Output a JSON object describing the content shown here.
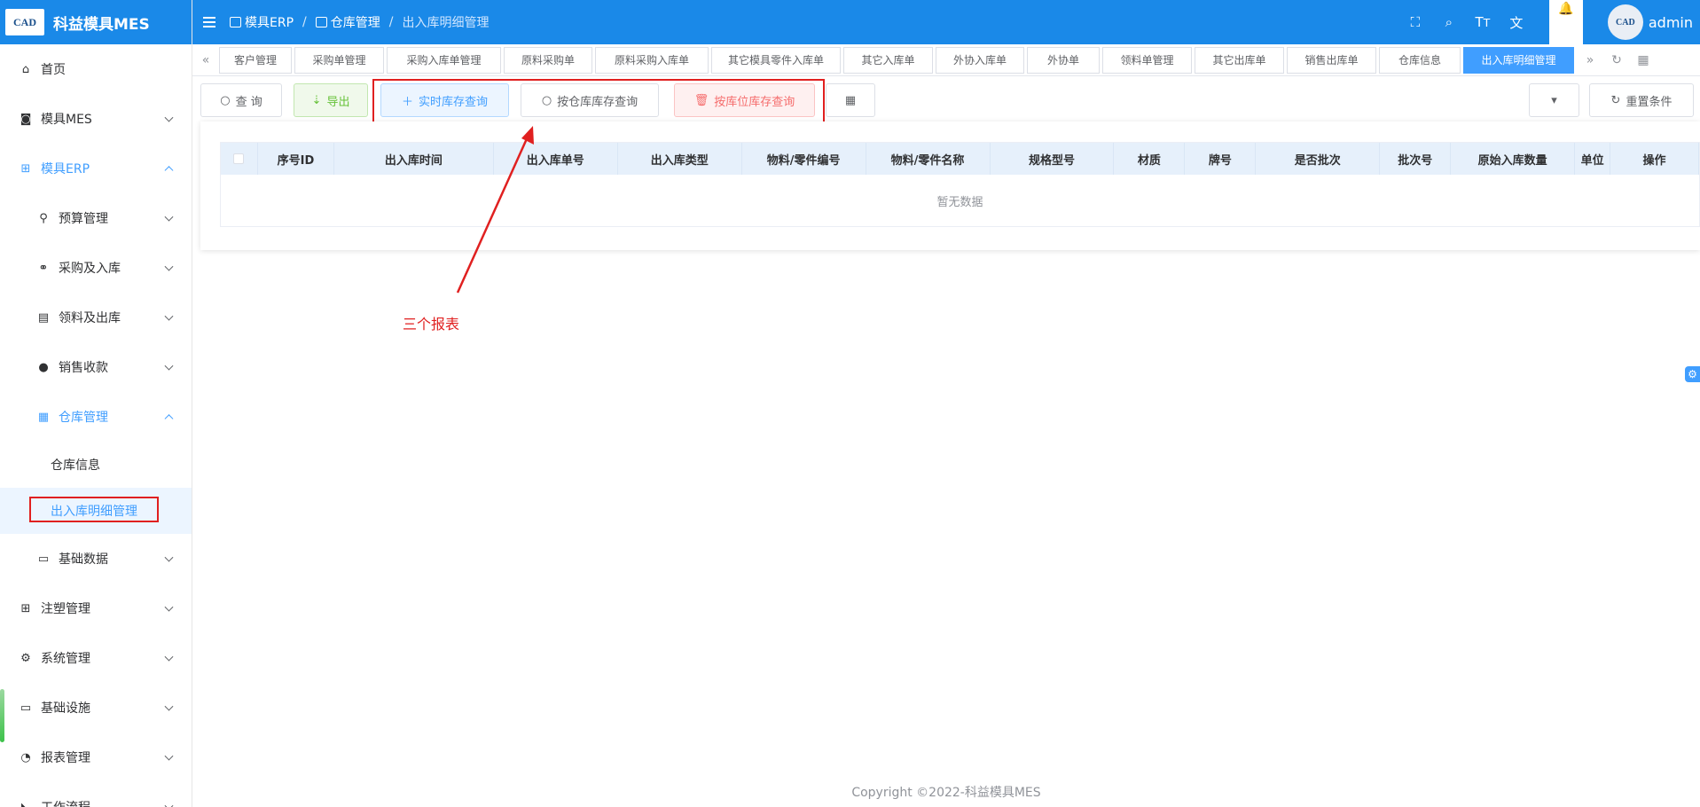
{
  "app": {
    "logo_badge": "CAD",
    "title": "科益模具MES"
  },
  "sidebar": {
    "items": [
      {
        "label": "首页",
        "icon": "home-icon"
      },
      {
        "label": "模具MES",
        "icon": "camera-icon"
      },
      {
        "label": "模具ERP",
        "icon": "gift-icon"
      },
      {
        "label": "预算管理",
        "icon": "budget-icon"
      },
      {
        "label": "采购及入库",
        "icon": "cycle-icon"
      },
      {
        "label": "领料及出库",
        "icon": "building-icon"
      },
      {
        "label": "销售收款",
        "icon": "user-icon"
      },
      {
        "label": "仓库管理",
        "icon": "calendar-icon"
      },
      {
        "label": "仓库信息"
      },
      {
        "label": "出入库明细管理"
      },
      {
        "label": "基础数据",
        "icon": "card-icon"
      },
      {
        "label": "注塑管理",
        "icon": "gift-icon"
      },
      {
        "label": "系统管理",
        "icon": "gear-icon"
      },
      {
        "label": "基础设施",
        "icon": "monitor-icon"
      },
      {
        "label": "报表管理",
        "icon": "pie-icon"
      },
      {
        "label": "工作流程",
        "icon": "flow-icon"
      }
    ]
  },
  "header": {
    "breadcrumb": [
      "模具ERP",
      "仓库管理",
      "出入库明细管理"
    ],
    "separator": "/",
    "user": "admin",
    "avatar_text": "CAD"
  },
  "tabs": [
    "客户管理",
    "采购单管理",
    "采购入库单管理",
    "原料采购单",
    "原料采购入库单",
    "其它模具零件入库单",
    "其它入库单",
    "外协入库单",
    "外协单",
    "领料单管理",
    "其它出库单",
    "销售出库单",
    "仓库信息",
    "出入库明细管理"
  ],
  "active_tab": "出入库明细管理",
  "toolbar": {
    "query": "查 询",
    "export": "导出",
    "realtime": "实时库存查询",
    "by_warehouse": "按仓库库存查询",
    "by_location": "按库位库存查询",
    "reset": "重置条件"
  },
  "table": {
    "columns": [
      "序号ID",
      "出入库时间",
      "出入库单号",
      "出入库类型",
      "物料/零件编号",
      "物料/零件名称",
      "规格型号",
      "材质",
      "牌号",
      "是否批次",
      "批次号",
      "原始入库数量",
      "单位",
      "操作"
    ],
    "empty_text": "暂无数据"
  },
  "annotation": {
    "text": "三个报表",
    "color": "#e02020"
  },
  "footer": {
    "copyright": "Copyright ©2022-科益模具MES"
  },
  "colors": {
    "primary": "#1a89e8",
    "accent": "#409eff"
  }
}
